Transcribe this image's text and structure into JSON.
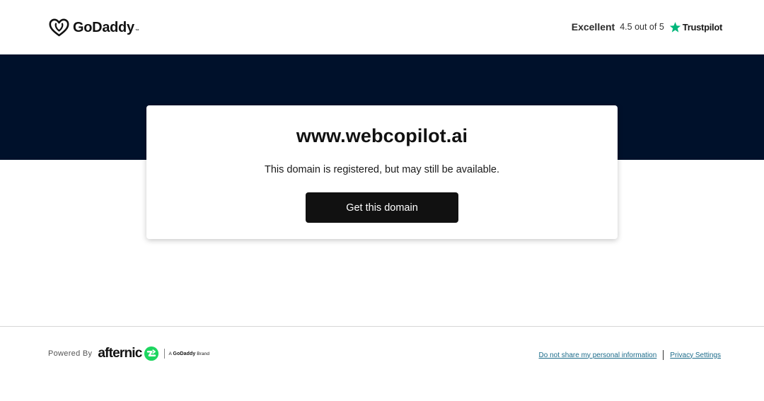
{
  "header": {
    "logo_text": "GoDaddy",
    "logo_tm": "™",
    "rating": {
      "label": "Excellent",
      "score": "4.5 out of 5",
      "provider": "Trustpilot",
      "star_color": "#00b67a"
    }
  },
  "hero": {
    "background_color": "#00112b"
  },
  "card": {
    "domain": "www.webcopilot.ai",
    "message": "This domain is registered, but may still be available.",
    "cta_label": "Get this domain"
  },
  "footer": {
    "powered_by_label": "Powered By",
    "partner_logo_text": "afternic",
    "brand_tag_prefix": "A",
    "brand_tag_brand": "GoDaddy",
    "brand_tag_suffix": "Brand",
    "links": [
      {
        "label": "Do not share my personal information"
      },
      {
        "label": "Privacy Settings"
      }
    ],
    "link_color": "#1b6b8a"
  }
}
